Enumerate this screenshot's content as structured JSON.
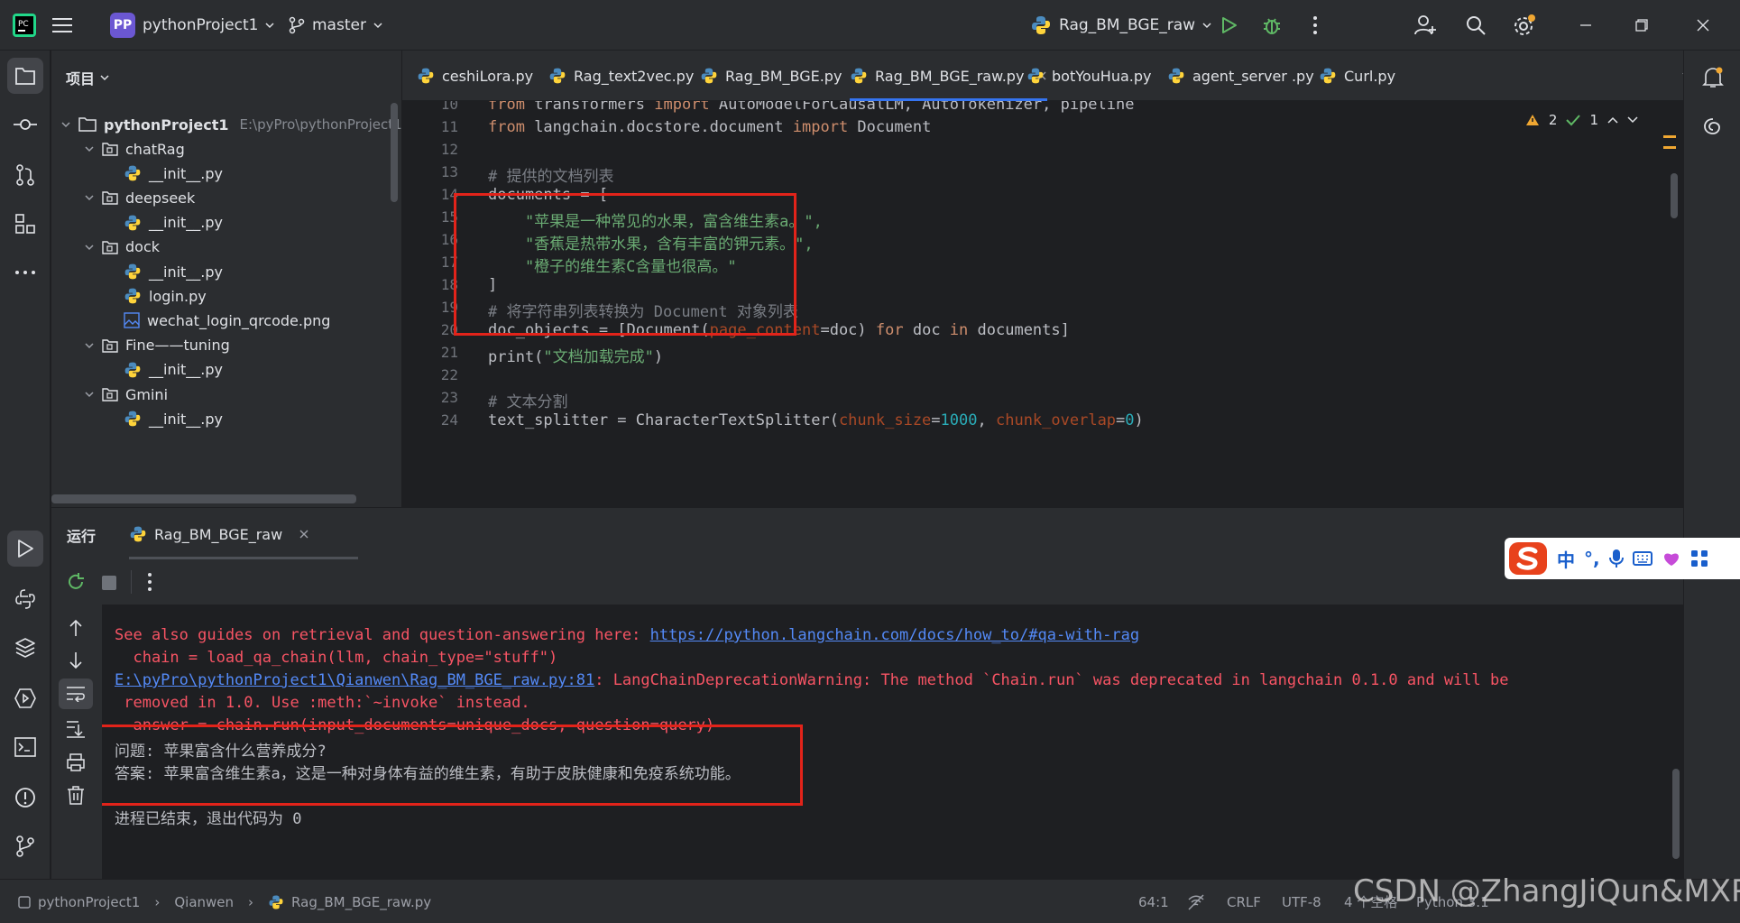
{
  "titlebar": {
    "project_name": "pythonProject1",
    "project_badge": "PP",
    "branch": "master",
    "run_config": "Rag_BM_BGE_raw"
  },
  "project_pane": {
    "title": "项目",
    "root": {
      "name": "pythonProject1",
      "path": "E:\\pyPro\\pythonProject1"
    },
    "items": [
      {
        "label": "chatRag",
        "type": "folder"
      },
      {
        "label": "__init__.py",
        "type": "file"
      },
      {
        "label": "deepseek",
        "type": "folder"
      },
      {
        "label": "__init__.py",
        "type": "file"
      },
      {
        "label": "dock",
        "type": "folder"
      },
      {
        "label": "__init__.py",
        "type": "file"
      },
      {
        "label": "login.py",
        "type": "file"
      },
      {
        "label": "wechat_login_qrcode.png",
        "type": "image"
      },
      {
        "label": "Fine——tuning",
        "type": "folder"
      },
      {
        "label": "__init__.py",
        "type": "file"
      },
      {
        "label": "Gmini",
        "type": "folder"
      },
      {
        "label": "__init__.py",
        "type": "file"
      }
    ]
  },
  "tabs": [
    "ceshiLora.py",
    "Rag_text2vec.py",
    "Rag_BM_BGE.py",
    "Rag_BM_BGE_raw.py",
    "botYouHua.py",
    "agent_server .py",
    "Curl.py"
  ],
  "active_tab": "Rag_BM_BGE_raw.py",
  "inspections": {
    "warnings": "2",
    "ok": "1"
  },
  "editor": {
    "line_numbers": [
      "10",
      "11",
      "12",
      "13",
      "14",
      "15",
      "16",
      "17",
      "18",
      "19",
      "20",
      "21",
      "22",
      "23",
      "24"
    ],
    "l10": {
      "kw1": "from",
      "mod": " transformers ",
      "kw2": "import",
      "names": " AutoModelForCausalLM, AutoTokenizer, pipeline"
    },
    "l11": {
      "kw1": "from",
      "mod": " langchain.docstore.document ",
      "kw2": "import",
      "names": " Document"
    },
    "l13": "# 提供的文档列表",
    "l14": "documents = [",
    "l15": "    \"苹果是一种常见的水果，富含维生素a。\",",
    "l16": "    \"香蕉是热带水果，含有丰富的钾元素。\",",
    "l17": "    \"橙子的维生素C含量也很高。\"",
    "l18": "]",
    "l19": "# 将字符串列表转换为 Document 对象列表",
    "l20": {
      "a": "doc_objects = [Document(",
      "param": "page_content",
      "b": "=doc) ",
      "kw1": "for",
      "c": " doc ",
      "kw2": "in",
      "d": " documents]"
    },
    "l21": {
      "a": "print(",
      "str": "\"文档加载完成\"",
      "b": ")"
    },
    "l23": "# 文本分割",
    "l24": {
      "a": "text_splitter = CharacterTextSplitter(",
      "p1": "chunk_size",
      "eq1": "=",
      "n1": "1000",
      "comma": ", ",
      "p2": "chunk_overlap",
      "eq2": "=",
      "n2": "0",
      "b": ")"
    }
  },
  "run_panel": {
    "title": "运行",
    "tab": "Rag_BM_BGE_raw"
  },
  "console": {
    "line1_text": "See also guides on retrieval and question-answering here: ",
    "line1_link": "https://python.langchain.com/docs/how_to/#qa-with-rag",
    "line2": "  chain = load_qa_chain(llm, chain_type=\"stuff\")",
    "line3_link": "E:\\pyPro\\pythonProject1\\Qianwen\\Rag_BM_BGE_raw.py:81",
    "line3_text": ": LangChainDeprecationWarning: The method `Chain.run` was deprecated in langchain 0.1.0 and will be",
    "line4": " removed in 1.0. Use :meth:`~invoke` instead.",
    "line5": "  answer = chain.run(input_documents=unique_docs, question=query)",
    "question": "问题: 苹果富含什么营养成分?",
    "answer": "答案: 苹果富含维生素a，这是一种对身体有益的维生素，有助于皮肤健康和免疫系统功能。",
    "exit": "进程已结束，退出代码为 0"
  },
  "statusbar": {
    "crumbs": [
      "pythonProject1",
      "Qianwen",
      "Rag_BM_BGE_raw.py"
    ],
    "position": "64:1",
    "line_sep": "CRLF",
    "encoding": "UTF-8",
    "indent": "4 个空格",
    "interpreter": "Python 3.1"
  },
  "ime": {
    "lang": "中",
    "punct": "°,"
  },
  "watermark": "CSDN @ZhangJiQun&MXP",
  "colors": {
    "accent": "#3574f0",
    "red_box": "#e2231a",
    "error_text": "#f75464",
    "link": "#548af7"
  }
}
